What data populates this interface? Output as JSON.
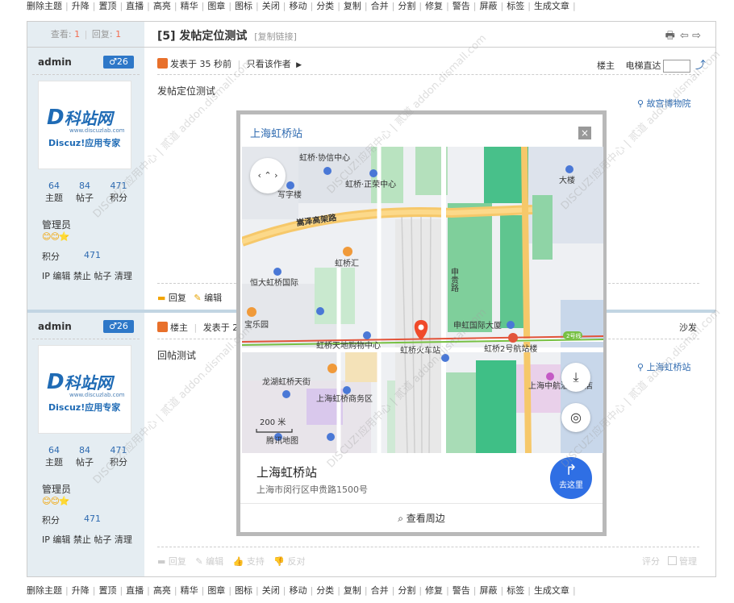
{
  "mod_actions": [
    "删除主题",
    "升降",
    "置顶",
    "直播",
    "高亮",
    "精华",
    "图章",
    "图标",
    "关闭",
    "移动",
    "分类",
    "复制",
    "合并",
    "分割",
    "修复",
    "警告",
    "屏蔽",
    "标签",
    "生成文章"
  ],
  "thread": {
    "views_label": "查看:",
    "views": "1",
    "replies_label": "回复:",
    "replies": "1",
    "title": "[5] 发帖定位测试",
    "copy_link": "[复制链接]"
  },
  "posts": [
    {
      "author": "admin",
      "badge": "♂26",
      "head_text": "发表于 35 秒前",
      "only_author": "只看该作者",
      "floor": "楼主",
      "jump_label": "电梯直达",
      "content": "发帖定位测试",
      "location": "故宫博物院",
      "stats": [
        {
          "num": "64",
          "label": "主题"
        },
        {
          "num": "84",
          "label": "帖子"
        },
        {
          "num": "471",
          "label": "积分"
        }
      ],
      "group": "管理员",
      "points_label": "积分",
      "points": "471",
      "tools": "IP 编辑 禁止 帖子 清理",
      "actions": {
        "reply": "回复",
        "edit": "编辑"
      }
    },
    {
      "author": "admin",
      "badge": "♂26",
      "floor_prefix": "楼主",
      "head_text": "发表于 2",
      "floor": "沙发",
      "content": "回帖测试",
      "location": "上海虹桥站",
      "stats": [
        {
          "num": "64",
          "label": "主题"
        },
        {
          "num": "84",
          "label": "帖子"
        },
        {
          "num": "471",
          "label": "积分"
        }
      ],
      "group": "管理员",
      "points_label": "积分",
      "points": "471",
      "tools": "IP 编辑 禁止 帖子 清理",
      "actions": {
        "reply": "回复",
        "edit": "编辑",
        "support": "支持",
        "oppose": "反对",
        "rate": "评分",
        "manage": "管理"
      }
    }
  ],
  "avatar": {
    "logo_main": "科站网",
    "logo_url": "www.discuzlab.com",
    "logo_sub": "Discuz!应用专家"
  },
  "map_popup": {
    "title": "上海虹桥站",
    "close": "×",
    "place_name": "上海虹桥站",
    "place_address": "上海市闵行区申贵路1500号",
    "go_label": "去这里",
    "nearby": "查看周边",
    "scale": "200 米",
    "provider": "腾讯地图",
    "labels": {
      "l1": "虹桥·协信中心",
      "l2": "虹桥·正荣中心",
      "l3": "大楼",
      "l4": "写字楼",
      "l5": "嵩泽高架路",
      "l6": "虹桥汇",
      "l7": "申贵路",
      "l8": "恒大虹桥国际",
      "l9": "宝乐园",
      "l10": "申虹国际大厦",
      "l11": "虹桥天地购物中心",
      "l12": "虹桥火车站",
      "l13": "虹桥2号航站楼",
      "l14": "龙湖虹桥天街",
      "l15": "上海虹桥商务区",
      "l16": "上海中航泊悦酒店",
      "l17": "2号线"
    }
  },
  "watermark": "DISCUZ!应用中心 | 贰道 addon.dismall.com",
  "colors": {
    "accent": "#2e6ab0",
    "sidebar": "#e5edf2",
    "badge": "#2e78c8",
    "go": "#2f6fe4",
    "pin": "#f04a2a"
  }
}
